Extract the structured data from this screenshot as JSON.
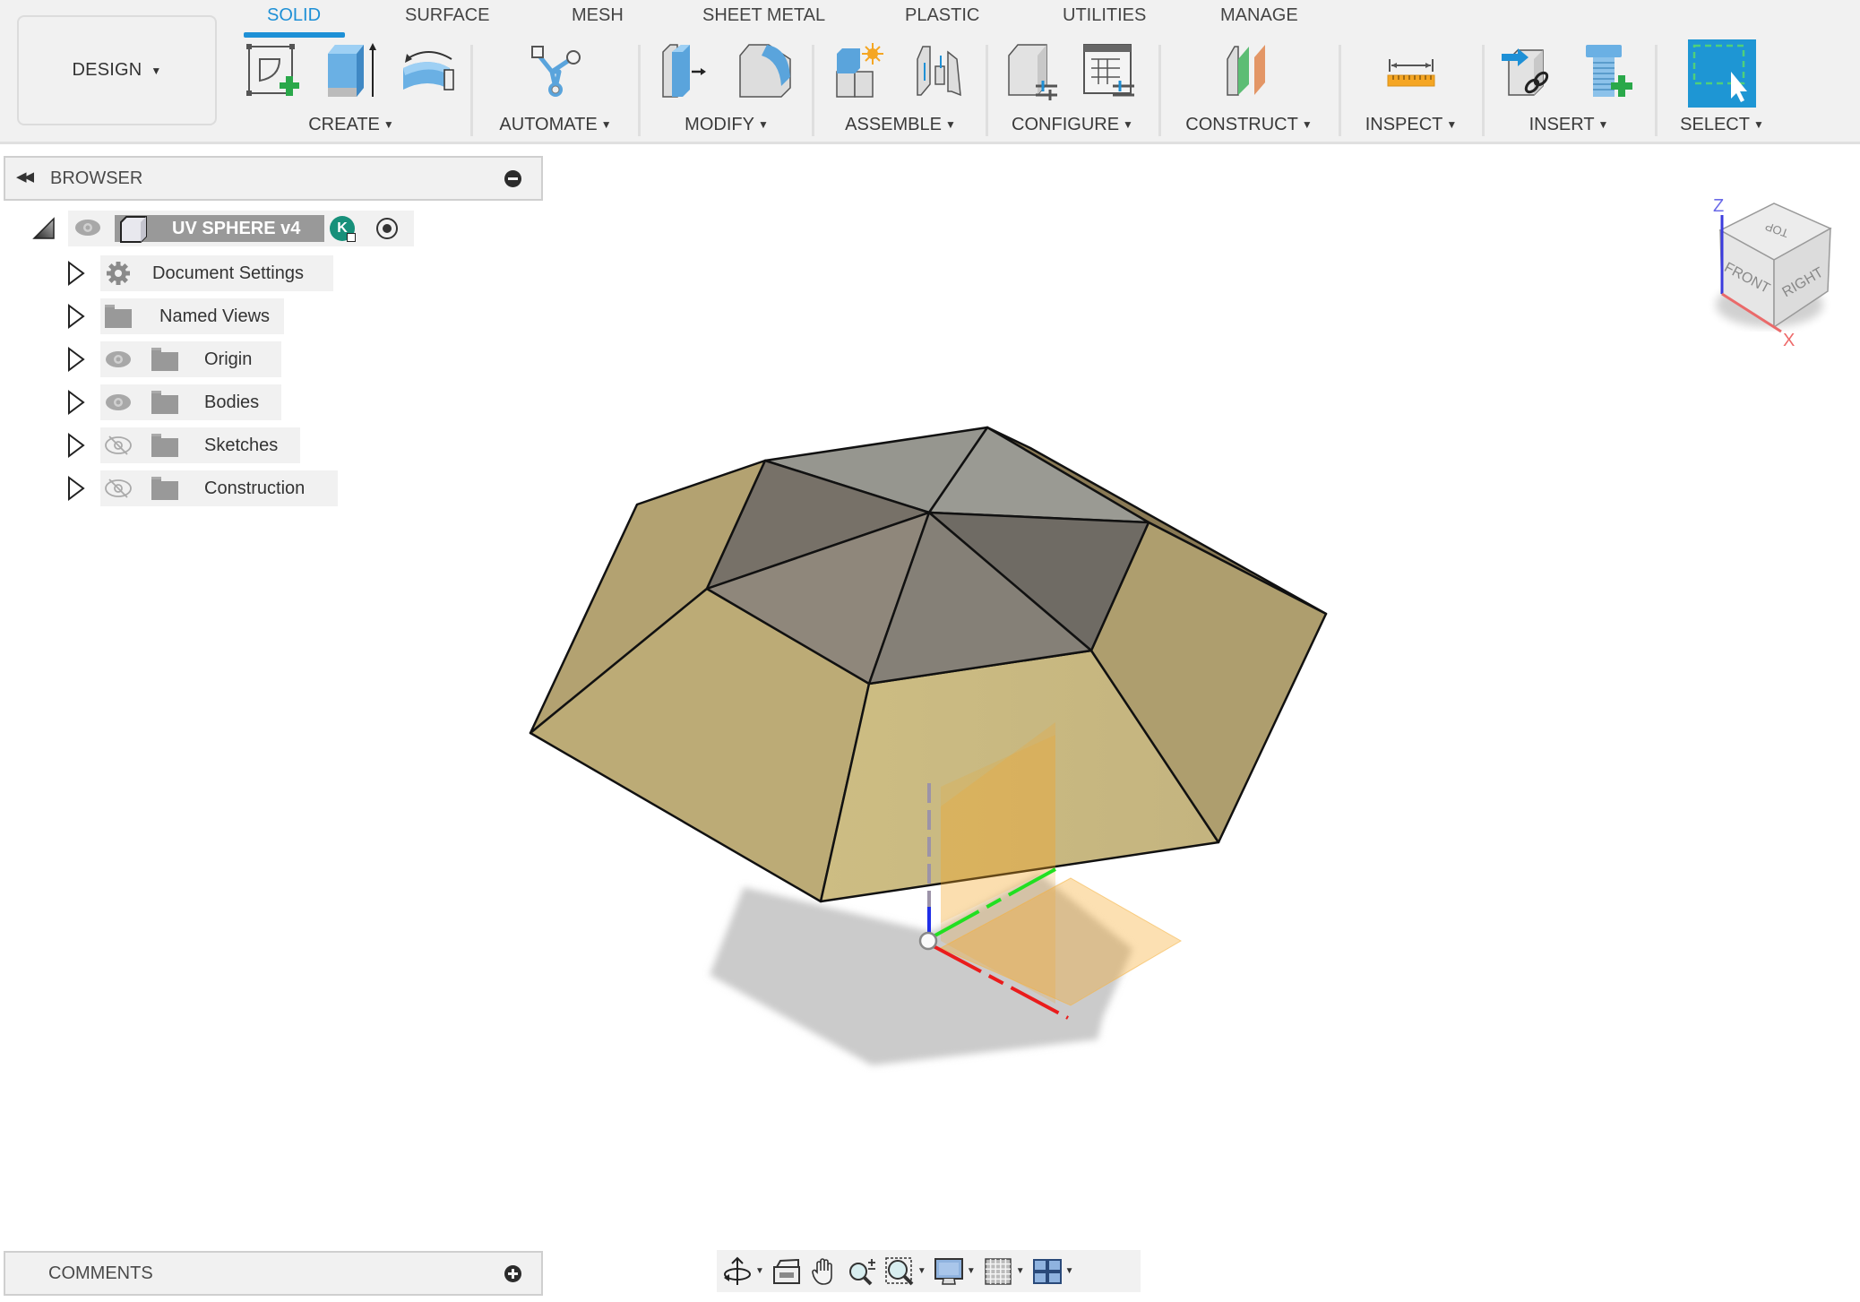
{
  "workspace": {
    "label": "DESIGN"
  },
  "tabs": [
    {
      "label": "SOLID",
      "active": true
    },
    {
      "label": "SURFACE",
      "active": false
    },
    {
      "label": "MESH",
      "active": false
    },
    {
      "label": "SHEET METAL",
      "active": false
    },
    {
      "label": "PLASTIC",
      "active": false
    },
    {
      "label": "UTILITIES",
      "active": false
    },
    {
      "label": "MANAGE",
      "active": false
    }
  ],
  "groups": [
    {
      "label": "CREATE",
      "icons": [
        "create-sketch-icon",
        "extrude-icon",
        "revolve-icon"
      ]
    },
    {
      "label": "AUTOMATE",
      "icons": [
        "automate-icon"
      ]
    },
    {
      "label": "MODIFY",
      "icons": [
        "press-pull-icon",
        "fillet-icon"
      ]
    },
    {
      "label": "ASSEMBLE",
      "icons": [
        "new-component-icon",
        "joint-icon"
      ]
    },
    {
      "label": "CONFIGURE",
      "icons": [
        "configure-model-icon",
        "configuration-table-icon"
      ]
    },
    {
      "label": "CONSTRUCT",
      "icons": [
        "offset-plane-icon"
      ]
    },
    {
      "label": "INSPECT",
      "icons": [
        "measure-icon"
      ]
    },
    {
      "label": "INSERT",
      "icons": [
        "insert-derive-icon",
        "insert-fastener-icon"
      ]
    },
    {
      "label": "SELECT",
      "icons": [
        "select-window-icon"
      ]
    }
  ],
  "browser": {
    "title": "BROWSER",
    "root": {
      "label": "UV SPHERE v4",
      "user_badge": "K"
    },
    "nodes": [
      {
        "label": "Document Settings",
        "icon": "gear-icon",
        "visibility": null
      },
      {
        "label": "Named Views",
        "icon": "folder-icon",
        "visibility": null
      },
      {
        "label": "Origin",
        "icon": "folder-icon",
        "visibility": "visible"
      },
      {
        "label": "Bodies",
        "icon": "folder-icon",
        "visibility": "visible"
      },
      {
        "label": "Sketches",
        "icon": "folder-icon",
        "visibility": "hidden"
      },
      {
        "label": "Construction",
        "icon": "folder-icon",
        "visibility": "hidden"
      }
    ]
  },
  "comments": {
    "title": "COMMENTS"
  },
  "viewcube": {
    "top": "TOP",
    "front": "FRONT",
    "right": "RIGHT",
    "axis_z": "Z",
    "axis_x": "X"
  },
  "navbar": [
    {
      "name": "orbit-icon",
      "dropdown": true
    },
    {
      "name": "look-at-icon",
      "dropdown": false
    },
    {
      "name": "pan-icon",
      "dropdown": false
    },
    {
      "name": "zoom-icon",
      "dropdown": false
    },
    {
      "name": "fit-window-icon",
      "dropdown": true
    },
    {
      "name": "display-settings-icon",
      "dropdown": true
    },
    {
      "name": "grid-snaps-icon",
      "dropdown": true
    },
    {
      "name": "viewports-icon",
      "dropdown": true
    }
  ],
  "colors": {
    "accent": "#1e90d6",
    "body_face": "#c8b880",
    "top_face": "#8c887e",
    "select_blue": "#1e96d4"
  }
}
